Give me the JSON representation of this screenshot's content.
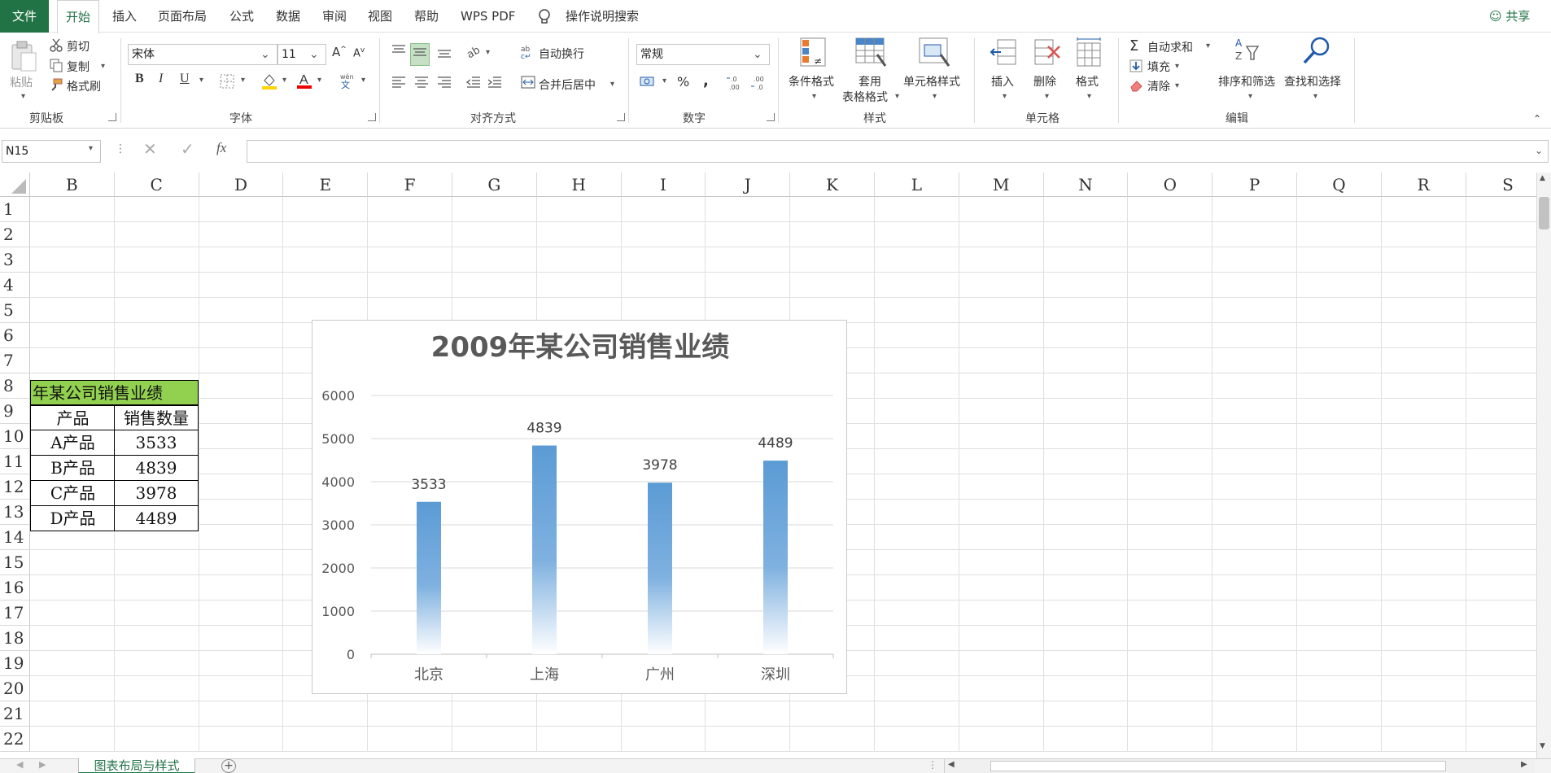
{
  "menu": {
    "tabs": [
      "文件",
      "开始",
      "插入",
      "页面布局",
      "公式",
      "数据",
      "审阅",
      "视图",
      "帮助",
      "WPS PDF"
    ],
    "search_label": "操作说明搜索",
    "share_label": "共享"
  },
  "ribbon": {
    "clipboard": {
      "paste": "粘贴",
      "cut": "剪切",
      "copy": "复制",
      "format_painter": "格式刷",
      "label": "剪贴板"
    },
    "font": {
      "name": "宋体",
      "size": "11",
      "label": "字体",
      "bold": "B",
      "italic": "I",
      "underline": "U"
    },
    "alignment": {
      "wrap": "自动换行",
      "merge": "合并后居中",
      "label": "对齐方式"
    },
    "number": {
      "format": "常规",
      "percent": "%",
      "comma": ",",
      "label": "数字"
    },
    "styles": {
      "conditional": "条件格式",
      "table_line1": "套用",
      "table_line2": "表格格式",
      "cell_styles": "单元格样式",
      "label": "样式"
    },
    "cells": {
      "insert": "插入",
      "delete": "删除",
      "format": "格式",
      "label": "单元格"
    },
    "editing": {
      "autosum": "自动求和",
      "fill": "填充",
      "clear": "清除",
      "sort": "排序和筛选",
      "find": "查找和选择",
      "label": "编辑"
    }
  },
  "formula_bar": {
    "name_box": "N15",
    "fx": "fx",
    "value": ""
  },
  "grid": {
    "columns": [
      "B",
      "C",
      "D",
      "E",
      "F",
      "G",
      "H",
      "I",
      "J",
      "K",
      "L",
      "M",
      "N",
      "O",
      "P",
      "Q",
      "R",
      "S"
    ],
    "rows": [
      "1",
      "2",
      "3",
      "4",
      "5",
      "6",
      "7",
      "8",
      "9",
      "10",
      "11",
      "12",
      "13",
      "14",
      "15",
      "16",
      "17",
      "18",
      "19",
      "20",
      "21",
      "22"
    ],
    "table": {
      "title": "年某公司销售业绩",
      "headers": [
        "产品",
        "销售数量"
      ],
      "rows": [
        [
          "A产品",
          "3533"
        ],
        [
          "B产品",
          "4839"
        ],
        [
          "C产品",
          "3978"
        ],
        [
          "D产品",
          "4489"
        ]
      ]
    }
  },
  "chart_data": {
    "type": "bar",
    "title": "2009年某公司销售业绩",
    "categories": [
      "北京",
      "上海",
      "广州",
      "深圳"
    ],
    "values": [
      3533,
      4839,
      3978,
      4489
    ],
    "ylim": [
      0,
      6000
    ],
    "yticks": [
      "0",
      "1000",
      "2000",
      "3000",
      "4000",
      "5000",
      "6000"
    ],
    "grid": true,
    "bar_color": "#5b9bd5",
    "data_labels": [
      "3533",
      "4839",
      "3978",
      "4489"
    ]
  },
  "sheets": {
    "active": "图表布局与样式",
    "add": "+"
  },
  "colors": {
    "accent": "#217346",
    "table_header": "#92d050"
  }
}
